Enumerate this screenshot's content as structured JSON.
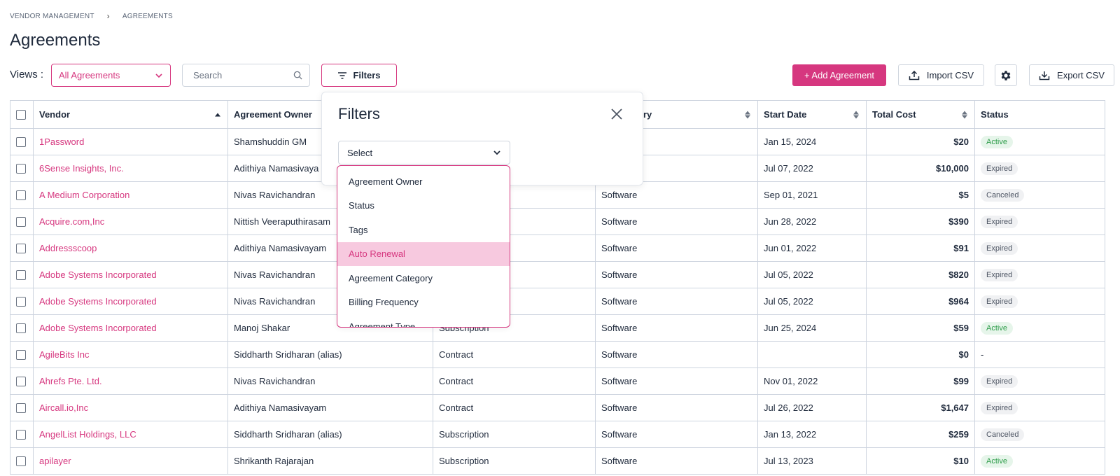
{
  "breadcrumb": {
    "root": "VENDOR MANAGEMENT",
    "current": "AGREEMENTS"
  },
  "page": {
    "title": "Agreements"
  },
  "toolbar": {
    "views_label": "Views :",
    "views_value": "All Agreements",
    "search_placeholder": "Search",
    "filters_label": "Filters",
    "add_label": "+ Add Agreement",
    "import_label": "Import CSV",
    "export_label": "Export CSV"
  },
  "colors": {
    "accent": "#d6377f",
    "active_green": "#2e9d4a"
  },
  "table": {
    "headers": {
      "vendor": "Vendor",
      "owner": "Agreement Owner",
      "type": "",
      "category": "nt Category",
      "start": "Start Date",
      "cost": "Total Cost",
      "status": "Status"
    },
    "rows": [
      {
        "vendor": "1Password",
        "owner": "Shamshuddin GM",
        "type": "",
        "category": "",
        "start": "Jan 15, 2024",
        "cost": "$20",
        "status": "Active"
      },
      {
        "vendor": "6Sense Insights, Inc.",
        "owner": "Adithiya Namasivaya",
        "type": "",
        "category": "",
        "start": "Jul 07, 2022",
        "cost": "$10,000",
        "status": "Expired"
      },
      {
        "vendor": "A Medium Corporation",
        "owner": "Nivas Ravichandran",
        "type": "",
        "category": "Software",
        "start": "Sep 01, 2021",
        "cost": "$5",
        "status": "Canceled"
      },
      {
        "vendor": "Acquire.com,Inc",
        "owner": "Nittish Veeraputhirasam",
        "type": "",
        "category": "Software",
        "start": "Jun 28, 2022",
        "cost": "$390",
        "status": "Expired"
      },
      {
        "vendor": "Addressscoop",
        "owner": "Adithiya Namasivayam",
        "type": "",
        "category": "Software",
        "start": "Jun 01, 2022",
        "cost": "$91",
        "status": "Expired"
      },
      {
        "vendor": "Adobe Systems Incorporated",
        "owner": "Nivas Ravichandran",
        "type": "",
        "category": "Software",
        "start": "Jul 05, 2022",
        "cost": "$820",
        "status": "Expired"
      },
      {
        "vendor": "Adobe Systems Incorporated",
        "owner": "Nivas Ravichandran",
        "type": "",
        "category": "Software",
        "start": "Jul 05, 2022",
        "cost": "$964",
        "status": "Expired"
      },
      {
        "vendor": "Adobe Systems Incorporated",
        "owner": "Manoj Shakar",
        "type": "Subscription",
        "category": "Software",
        "start": "Jun 25, 2024",
        "cost": "$59",
        "status": "Active"
      },
      {
        "vendor": "AgileBits Inc",
        "owner": "Siddharth Sridharan (alias)",
        "type": "Contract",
        "category": "Software",
        "start": "",
        "cost": "$0",
        "status": "-"
      },
      {
        "vendor": "Ahrefs Pte. Ltd.",
        "owner": "Nivas Ravichandran",
        "type": "Contract",
        "category": "Software",
        "start": "Nov 01, 2022",
        "cost": "$99",
        "status": "Expired"
      },
      {
        "vendor": "Aircall.io,Inc",
        "owner": "Adithiya Namasivayam",
        "type": "Contract",
        "category": "Software",
        "start": "Jul 26, 2022",
        "cost": "$1,647",
        "status": "Expired"
      },
      {
        "vendor": "AngelList Holdings, LLC",
        "owner": "Siddharth Sridharan (alias)",
        "type": "Subscription",
        "category": "Software",
        "start": "Jan 13, 2022",
        "cost": "$259",
        "status": "Canceled"
      },
      {
        "vendor": "apilayer",
        "owner": "Shrikanth Rajarajan",
        "type": "Subscription",
        "category": "Software",
        "start": "Jul 13, 2023",
        "cost": "$10",
        "status": "Active"
      }
    ]
  },
  "filters_panel": {
    "title": "Filters",
    "select_placeholder": "Select",
    "options": [
      "Agreement Owner",
      "Status",
      "Tags",
      "Auto Renewal",
      "Agreement Category",
      "Billing Frequency",
      "Agreement Type"
    ],
    "highlighted": "Auto Renewal"
  }
}
